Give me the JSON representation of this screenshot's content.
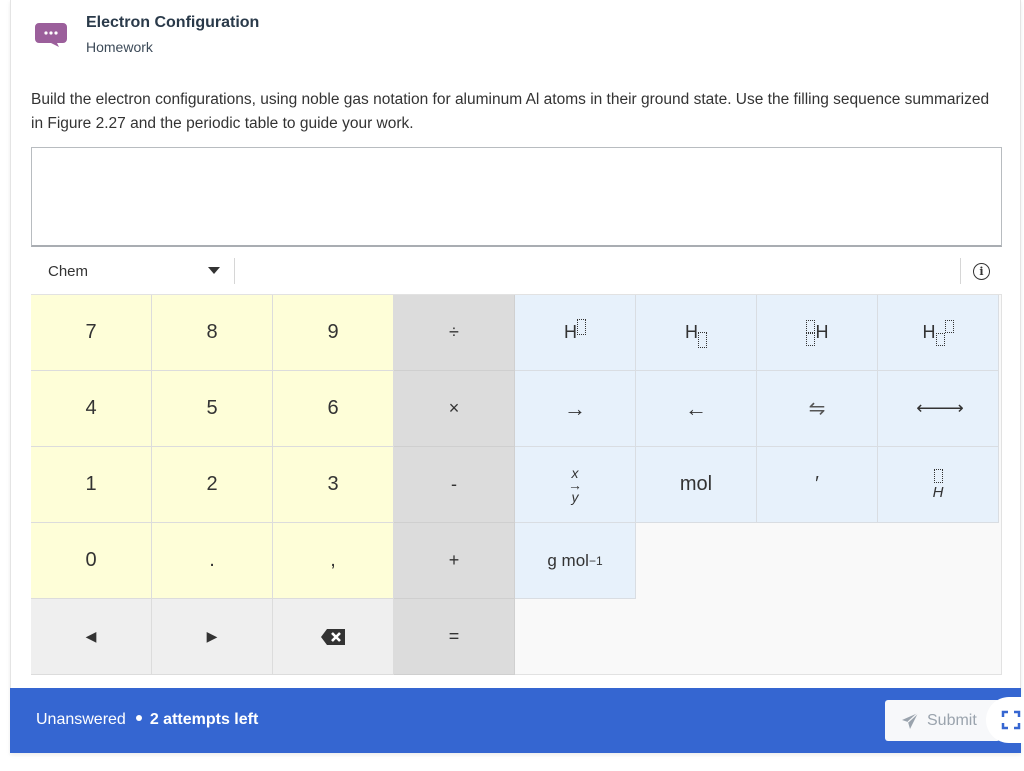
{
  "header": {
    "title": "Electron Configuration",
    "subtitle": "Homework",
    "icon": "chat-bubble-icon",
    "icon_color": "#9b5f9b"
  },
  "question": {
    "text": "Build the electron configurations, using noble gas notation for aluminum Al atoms in their ground state. Use the filling sequence summarized in Figure 2.27 and the periodic table to guide your work."
  },
  "answer_box": {
    "value": ""
  },
  "toolbar": {
    "mode_selected": "Chem",
    "info_icon": "info-icon"
  },
  "keypad": {
    "numbers": [
      "7",
      "8",
      "9",
      "4",
      "5",
      "6",
      "1",
      "2",
      "3",
      "0",
      ".",
      ","
    ],
    "operators": [
      "÷",
      "×",
      "-",
      "+",
      "="
    ],
    "navigation": {
      "left": "◀",
      "right": "▶",
      "backspace": "backspace-icon"
    },
    "chem_keys": {
      "superscript": "H",
      "subscript": "H",
      "pre_super_sub": "H",
      "super_sub": "H",
      "right_arrow": "→",
      "left_arrow": "←",
      "equilibrium": "⇋",
      "resonance": "⟵⟶",
      "reaction_x": "x",
      "reaction_y": "y",
      "mol": "mol",
      "prime": "′",
      "under_h": "H",
      "molar_mass_base": "g mol",
      "molar_mass_exp": "−1"
    }
  },
  "footer": {
    "status": "Unanswered",
    "attempts": "2 attempts left",
    "submit_label": "Submit",
    "background_color": "#3566d1"
  }
}
